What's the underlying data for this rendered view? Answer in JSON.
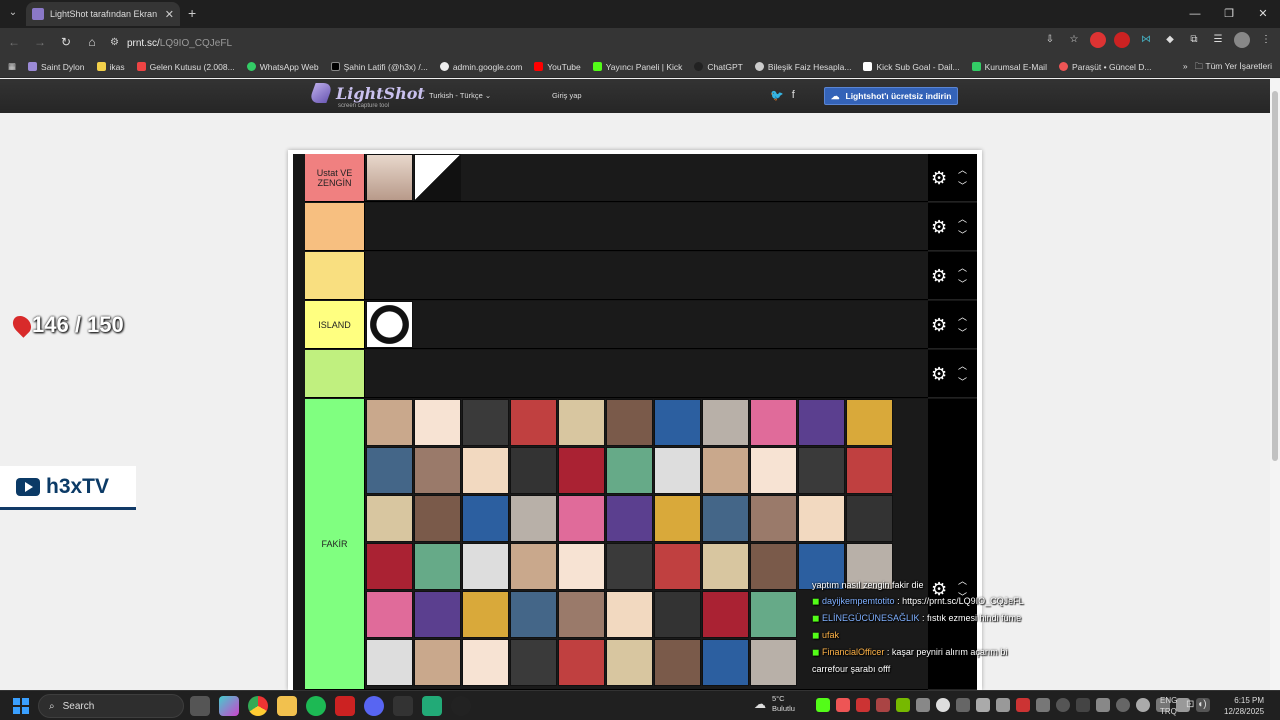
{
  "browser": {
    "tab_title": "LightShot tarafından Ekran Görü",
    "url_domain": "prnt.sc/",
    "url_path": "LQ9IO_CQJeFL",
    "bookmarks": [
      "Saint Dylon",
      "ikas",
      "Gelen Kutusu (2.008...",
      "WhatsApp Web",
      "Şahin Latifi (@h3x) /...",
      "admin.google.com",
      "YouTube",
      "Yayıncı Paneli | Kick",
      "ChatGPT",
      "Bileşik Faiz Hesapla...",
      "Kick Sub Goal - Dail...",
      "Kurumsal E-Mail",
      "Paraşüt • Güncel D..."
    ],
    "all_bookmarks": "Tüm Yer İşaretleri"
  },
  "lightshot": {
    "logo": "LightShot",
    "tagline": "screen capture tool",
    "language": "Turkish - Türkçe",
    "login": "Giriş yap",
    "download_button": "Lightshot'ı ücretsiz indirin"
  },
  "tierlist": {
    "tiers": [
      {
        "label": "Ustat VE ZENGİN",
        "color": "#f08080"
      },
      {
        "label": "",
        "color": "#f7bf80"
      },
      {
        "label": "",
        "color": "#f9df80"
      },
      {
        "label": "ISLAND",
        "color": "#ffff80"
      },
      {
        "label": "",
        "color": "#c0f07f"
      },
      {
        "label": "FAKİR",
        "color": "#80ff80"
      }
    ]
  },
  "overlay": {
    "counter": "146 / 150",
    "channel": "h3xTV"
  },
  "chat": [
    {
      "user": "",
      "text": "yaptım nasıl zengin fakir die"
    },
    {
      "user": "dayijkempemtotito",
      "text": ": https://prnt.sc/LQ9IO_CQJeFL"
    },
    {
      "user": "ELİNEGÜCÜNESAĞLIK",
      "text": ": fıstık ezmesi hindi füme"
    },
    {
      "user": "",
      "text": "ufak"
    },
    {
      "user": "FinancialOfficer",
      "text": ": kaşar peyniri alırım açarım bi"
    },
    {
      "user": "",
      "text": "carrefour şarabı offf"
    }
  ],
  "taskbar": {
    "search": "Search",
    "weather_temp": "5°C",
    "weather_desc": "Bulutlu",
    "lang1": "ENG",
    "lang2": "TRQ",
    "time": "6:15 PM",
    "date": "12/28/2025"
  }
}
